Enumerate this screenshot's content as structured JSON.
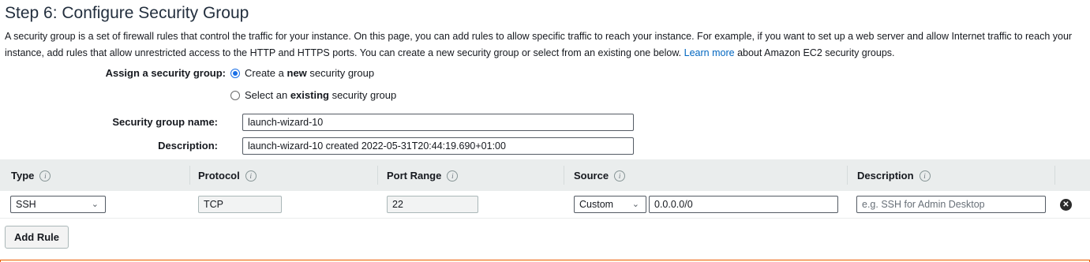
{
  "header": {
    "title": "Step 6: Configure Security Group",
    "intro_text": "A security group is a set of firewall rules that control the traffic for your instance. On this page, you can add rules to allow specific traffic to reach your instance. For example, if you want to set up a web server and allow Internet traffic to reach your instance, add rules that allow unrestricted access to the HTTP and HTTPS ports. You can create a new security group or select from an existing one below.",
    "learn_more_link": "Learn more",
    "intro_suffix": "about Amazon EC2 security groups."
  },
  "assign": {
    "label": "Assign a security group:",
    "option_new_prefix": "Create a",
    "option_new_bold": "new",
    "option_new_suffix": "security group",
    "option_existing_prefix": "Select an",
    "option_existing_bold": "existing",
    "option_existing_suffix": "security group",
    "selected": "new"
  },
  "group_name": {
    "label": "Security group name:",
    "value": "launch-wizard-10"
  },
  "description": {
    "label": "Description:",
    "value": "launch-wizard-10 created 2022-05-31T20:44:19.690+01:00"
  },
  "table": {
    "headers": {
      "type": "Type",
      "protocol": "Protocol",
      "port_range": "Port Range",
      "source": "Source",
      "description": "Description"
    },
    "info_glyph": "i",
    "rows": [
      {
        "type": "SSH",
        "protocol": "TCP",
        "port_range": "22",
        "source_mode": "Custom",
        "source_cidr": "0.0.0.0/0",
        "description_placeholder": "e.g. SSH for Admin Desktop"
      }
    ]
  },
  "icons": {
    "chevron": "chevron-down-icon",
    "remove": "remove-circle-icon",
    "info": "info-icon"
  },
  "buttons": {
    "add_rule": "Add Rule"
  },
  "colors": {
    "link": "#0066c0",
    "radio_selected": "#1a6fe6",
    "table_header_bg": "#eaeded",
    "warning_border": "#eb5f07"
  }
}
